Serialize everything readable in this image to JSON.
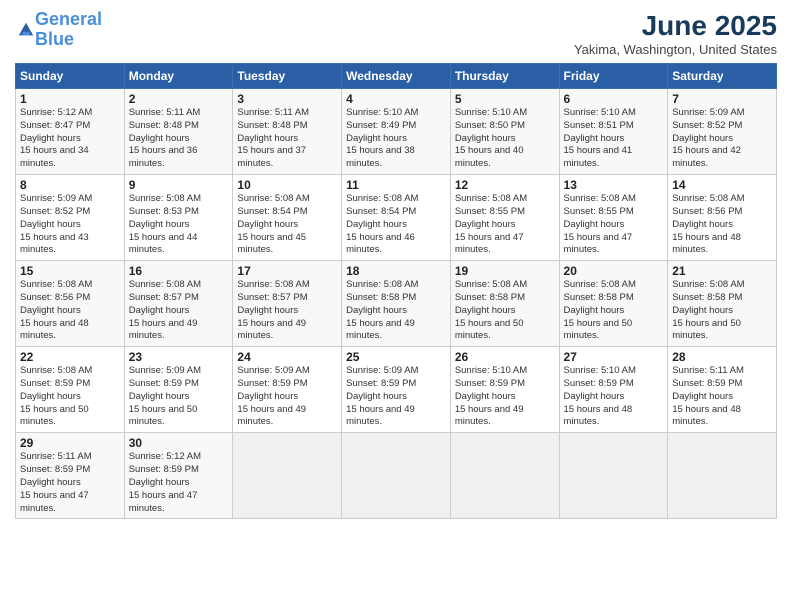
{
  "header": {
    "logo_line1": "General",
    "logo_line2": "Blue",
    "month_year": "June 2025",
    "location": "Yakima, Washington, United States"
  },
  "days_of_week": [
    "Sunday",
    "Monday",
    "Tuesday",
    "Wednesday",
    "Thursday",
    "Friday",
    "Saturday"
  ],
  "weeks": [
    [
      {
        "day": "1",
        "sunrise": "5:12 AM",
        "sunset": "8:47 PM",
        "daylight": "15 hours and 34 minutes."
      },
      {
        "day": "2",
        "sunrise": "5:11 AM",
        "sunset": "8:48 PM",
        "daylight": "15 hours and 36 minutes."
      },
      {
        "day": "3",
        "sunrise": "5:11 AM",
        "sunset": "8:48 PM",
        "daylight": "15 hours and 37 minutes."
      },
      {
        "day": "4",
        "sunrise": "5:10 AM",
        "sunset": "8:49 PM",
        "daylight": "15 hours and 38 minutes."
      },
      {
        "day": "5",
        "sunrise": "5:10 AM",
        "sunset": "8:50 PM",
        "daylight": "15 hours and 40 minutes."
      },
      {
        "day": "6",
        "sunrise": "5:10 AM",
        "sunset": "8:51 PM",
        "daylight": "15 hours and 41 minutes."
      },
      {
        "day": "7",
        "sunrise": "5:09 AM",
        "sunset": "8:52 PM",
        "daylight": "15 hours and 42 minutes."
      }
    ],
    [
      {
        "day": "8",
        "sunrise": "5:09 AM",
        "sunset": "8:52 PM",
        "daylight": "15 hours and 43 minutes."
      },
      {
        "day": "9",
        "sunrise": "5:08 AM",
        "sunset": "8:53 PM",
        "daylight": "15 hours and 44 minutes."
      },
      {
        "day": "10",
        "sunrise": "5:08 AM",
        "sunset": "8:54 PM",
        "daylight": "15 hours and 45 minutes."
      },
      {
        "day": "11",
        "sunrise": "5:08 AM",
        "sunset": "8:54 PM",
        "daylight": "15 hours and 46 minutes."
      },
      {
        "day": "12",
        "sunrise": "5:08 AM",
        "sunset": "8:55 PM",
        "daylight": "15 hours and 47 minutes."
      },
      {
        "day": "13",
        "sunrise": "5:08 AM",
        "sunset": "8:55 PM",
        "daylight": "15 hours and 47 minutes."
      },
      {
        "day": "14",
        "sunrise": "5:08 AM",
        "sunset": "8:56 PM",
        "daylight": "15 hours and 48 minutes."
      }
    ],
    [
      {
        "day": "15",
        "sunrise": "5:08 AM",
        "sunset": "8:56 PM",
        "daylight": "15 hours and 48 minutes."
      },
      {
        "day": "16",
        "sunrise": "5:08 AM",
        "sunset": "8:57 PM",
        "daylight": "15 hours and 49 minutes."
      },
      {
        "day": "17",
        "sunrise": "5:08 AM",
        "sunset": "8:57 PM",
        "daylight": "15 hours and 49 minutes."
      },
      {
        "day": "18",
        "sunrise": "5:08 AM",
        "sunset": "8:58 PM",
        "daylight": "15 hours and 49 minutes."
      },
      {
        "day": "19",
        "sunrise": "5:08 AM",
        "sunset": "8:58 PM",
        "daylight": "15 hours and 50 minutes."
      },
      {
        "day": "20",
        "sunrise": "5:08 AM",
        "sunset": "8:58 PM",
        "daylight": "15 hours and 50 minutes."
      },
      {
        "day": "21",
        "sunrise": "5:08 AM",
        "sunset": "8:58 PM",
        "daylight": "15 hours and 50 minutes."
      }
    ],
    [
      {
        "day": "22",
        "sunrise": "5:08 AM",
        "sunset": "8:59 PM",
        "daylight": "15 hours and 50 minutes."
      },
      {
        "day": "23",
        "sunrise": "5:09 AM",
        "sunset": "8:59 PM",
        "daylight": "15 hours and 50 minutes."
      },
      {
        "day": "24",
        "sunrise": "5:09 AM",
        "sunset": "8:59 PM",
        "daylight": "15 hours and 49 minutes."
      },
      {
        "day": "25",
        "sunrise": "5:09 AM",
        "sunset": "8:59 PM",
        "daylight": "15 hours and 49 minutes."
      },
      {
        "day": "26",
        "sunrise": "5:10 AM",
        "sunset": "8:59 PM",
        "daylight": "15 hours and 49 minutes."
      },
      {
        "day": "27",
        "sunrise": "5:10 AM",
        "sunset": "8:59 PM",
        "daylight": "15 hours and 48 minutes."
      },
      {
        "day": "28",
        "sunrise": "5:11 AM",
        "sunset": "8:59 PM",
        "daylight": "15 hours and 48 minutes."
      }
    ],
    [
      {
        "day": "29",
        "sunrise": "5:11 AM",
        "sunset": "8:59 PM",
        "daylight": "15 hours and 47 minutes."
      },
      {
        "day": "30",
        "sunrise": "5:12 AM",
        "sunset": "8:59 PM",
        "daylight": "15 hours and 47 minutes."
      },
      null,
      null,
      null,
      null,
      null
    ]
  ]
}
